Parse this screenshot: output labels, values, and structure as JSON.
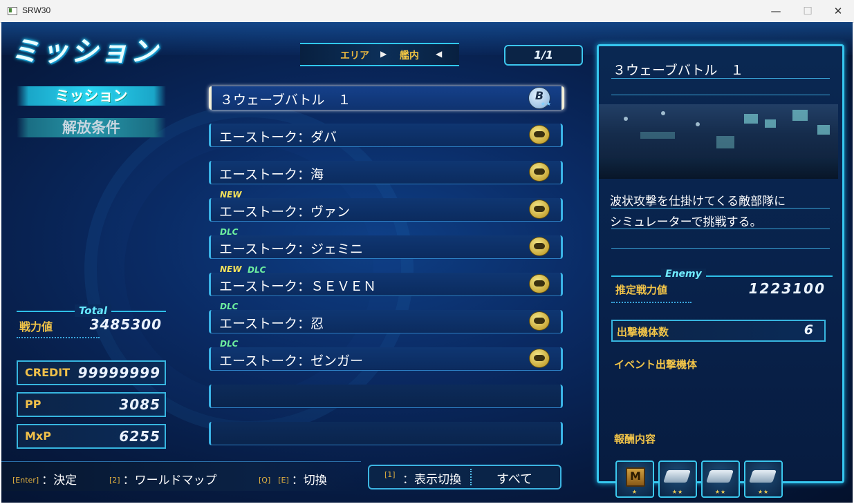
{
  "window": {
    "title": "SRW30",
    "min": "—",
    "max": "☐",
    "close": "✕"
  },
  "header": {
    "title": "ミッション",
    "area_label": "エリア",
    "area_value": "艦内",
    "page": "1/1"
  },
  "tabs": [
    {
      "label": "ミッション"
    },
    {
      "label": "解放条件"
    }
  ],
  "totals": {
    "section_label": "Total",
    "power_label": "戦力値",
    "power_value": "3485300",
    "credit_label": "CREDIT",
    "credit_value": "99999999",
    "pp_label": "PP",
    "pp_value": "3085",
    "mxp_label": "MxP",
    "mxp_value": "6255"
  },
  "missions": [
    {
      "name": "３ウェーブバトル　１",
      "icon": "rank-b-icon",
      "rank": "B",
      "stars": "★★",
      "badges": []
    },
    {
      "name": "エーストーク：ダバ",
      "icon": "chat-icon",
      "badges": []
    },
    {
      "name": "エーストーク：海",
      "icon": "chat-icon",
      "badges": []
    },
    {
      "name": "エーストーク：ヴァン",
      "icon": "chat-icon",
      "badges": [
        "NEW"
      ]
    },
    {
      "name": "エーストーク：ジェミニ",
      "icon": "chat-icon",
      "badges": [
        "DLC"
      ]
    },
    {
      "name": "エーストーク：ＳＥＶＥＮ",
      "icon": "chat-icon",
      "badges": [
        "NEW",
        "DLC"
      ]
    },
    {
      "name": "エーストーク：忍",
      "icon": "chat-icon",
      "badges": [
        "DLC"
      ]
    },
    {
      "name": "エーストーク：ゼンガー",
      "icon": "chat-icon",
      "badges": [
        "DLC"
      ]
    }
  ],
  "controls": {
    "confirm_key": "[Enter]",
    "confirm_label": "：決定",
    "map_key": "[2]",
    "map_label": "：ワールドマップ",
    "switch_keys": "[Q]　[E]",
    "switch_label": "：切換",
    "display_key": "[1]",
    "display_label": "：表示切換",
    "display_value": "すべて"
  },
  "detail": {
    "title": "３ウェーブバトル　１",
    "description_line1": "波状攻撃を仕掛けてくる敵部隊に",
    "description_line2": "シミュレーターで挑戦する。",
    "enemy_label": "Enemy",
    "estimated_power_label": "推定戦力値",
    "estimated_power_value": "1223100",
    "sortie_count_label": "出撃機体数",
    "sortie_count_value": "6",
    "event_units_label": "イベント出撃機体",
    "rewards_label": "報酬内容",
    "rewards": [
      {
        "icon": "m-item-icon",
        "letter": "M",
        "stars": "★"
      },
      {
        "icon": "usb-part-icon",
        "stars": "★★"
      },
      {
        "icon": "usb-part-icon",
        "stars": "★★"
      },
      {
        "icon": "usb-part-icon",
        "stars": "★★"
      }
    ]
  },
  "colors": {
    "accent": "#36c6ee",
    "label_gold": "#f2c448",
    "new_badge": "#f6e35a",
    "dlc_badge": "#6ef0a0"
  }
}
